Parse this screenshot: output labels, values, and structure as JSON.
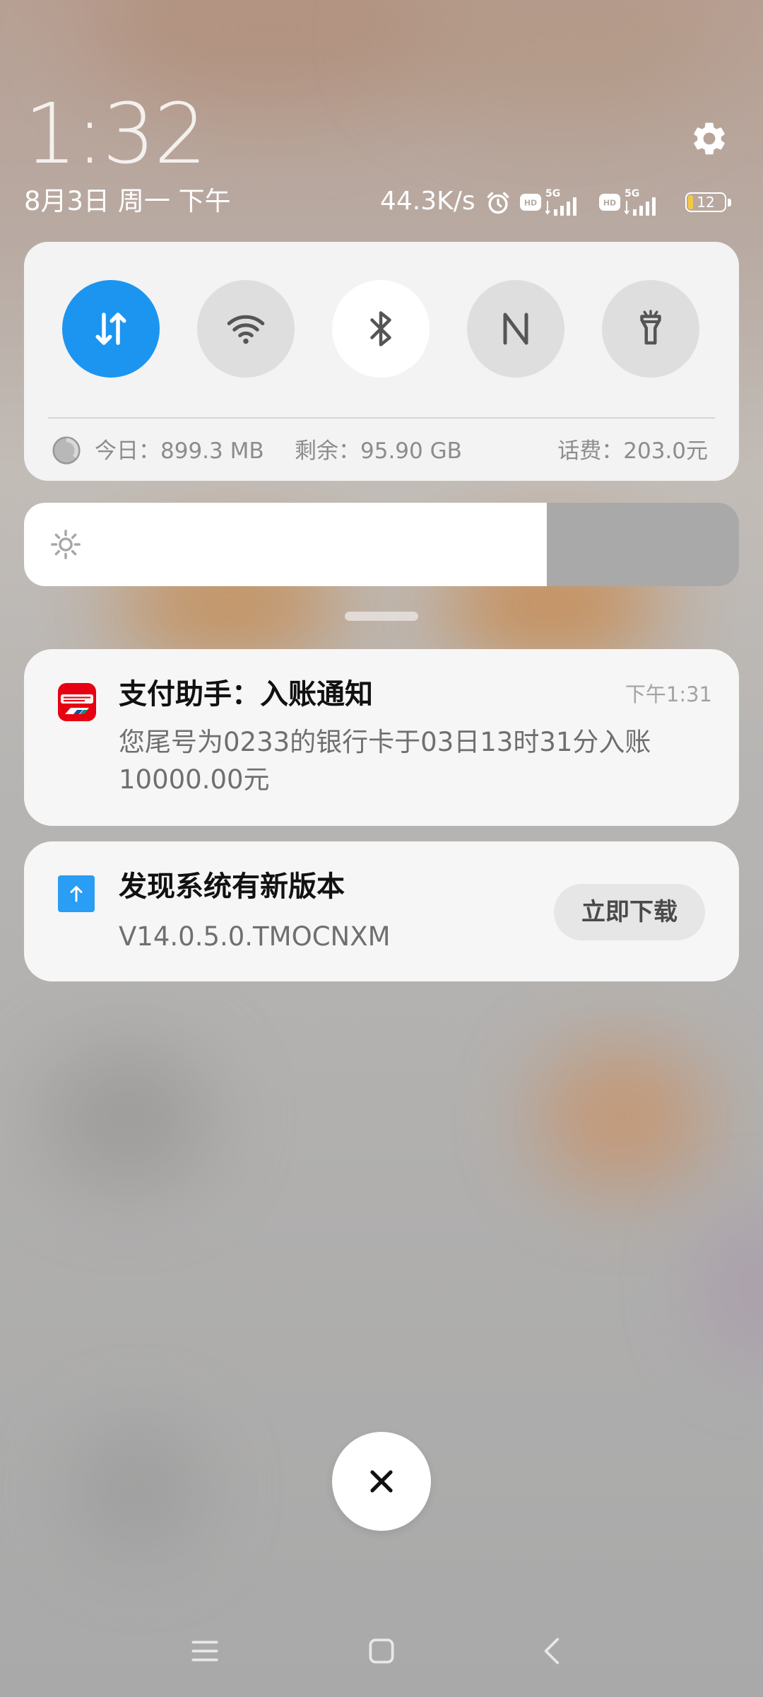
{
  "header": {
    "time": "1:32",
    "date": "8月3日 周一 下午",
    "net_speed": "44.3K/s",
    "battery": "12",
    "hd_label": "HD",
    "network_type": "5G"
  },
  "quick_settings": {
    "tiles": [
      {
        "name": "mobile-data",
        "icon": "arrows-updown-icon",
        "state": "on"
      },
      {
        "name": "wifi",
        "icon": "wifi-icon",
        "state": "off"
      },
      {
        "name": "bluetooth",
        "icon": "bluetooth-icon",
        "state": "on"
      },
      {
        "name": "nfc",
        "icon": "nfc-icon",
        "state": "off"
      },
      {
        "name": "flashlight",
        "icon": "flashlight-icon",
        "state": "off"
      }
    ],
    "data_today": "今日：899.3 MB",
    "data_remaining": "剩余：95.90 GB",
    "balance": "话费：203.0元"
  },
  "brightness": {
    "level": 0.731
  },
  "notifications": [
    {
      "app_icon": "unionpay-icon",
      "title": "支付助手：入账通知",
      "time": "下午1:31",
      "body_line1": "您尾号为0233的银行卡于03日13时31分入账",
      "body_line2": "10000.00元"
    },
    {
      "app_icon": "system-update-icon",
      "title": "发现系统有新版本",
      "body": "V14.0.5.0.TMOCNXM",
      "action_label": "立即下载"
    }
  ],
  "colors": {
    "accent": "#1b95f0",
    "card_bg": "#f3f3f3",
    "unionpay_red": "#e60012"
  }
}
